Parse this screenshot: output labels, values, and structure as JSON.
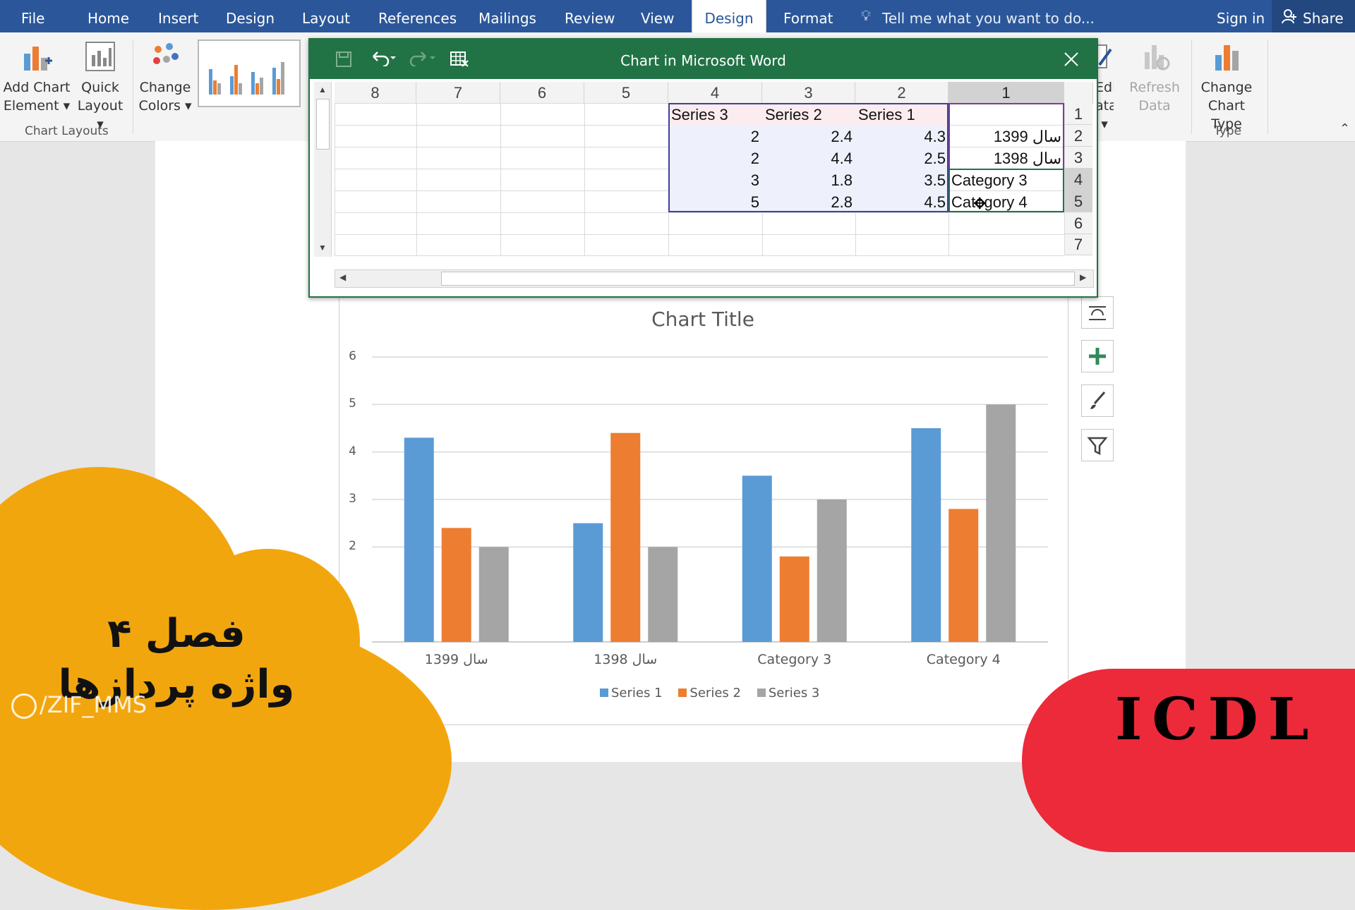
{
  "ribbon_tabs": {
    "file": "File",
    "home": "Home",
    "insert": "Insert",
    "design": "Design",
    "layout": "Layout",
    "references": "References",
    "mailings": "Mailings",
    "review": "Review",
    "view": "View",
    "chart_design": "Design",
    "format": "Format"
  },
  "tell_me": "Tell me what you want to do...",
  "sign_in": "Sign in",
  "share": "Share",
  "ribbon": {
    "add_chart_element": [
      "Add Chart",
      "Element ▾"
    ],
    "quick_layout": [
      "Quick",
      "Layout ▾"
    ],
    "change_colors": [
      "Change",
      "Colors ▾"
    ],
    "chart_layouts_group": "Chart Layouts",
    "edit_data": [
      "Edit",
      "ata ▾"
    ],
    "refresh_data": [
      "Refresh",
      "Data"
    ],
    "change_chart_type": [
      "Change",
      "Chart Type"
    ],
    "type_group": "Type"
  },
  "excel": {
    "title": "Chart in Microsoft Word",
    "columns": [
      "8",
      "7",
      "6",
      "5",
      "4",
      "3",
      "2",
      "1"
    ],
    "rows": [
      "1",
      "2",
      "3",
      "4",
      "5",
      "6",
      "7"
    ],
    "header": [
      "Series 3",
      "Series 2",
      "Series 1",
      ""
    ],
    "data": [
      [
        "2",
        "2.4",
        "4.3",
        "سال 1399"
      ],
      [
        "2",
        "4.4",
        "2.5",
        "سال 1398"
      ],
      [
        "3",
        "1.8",
        "3.5",
        "Category 3"
      ],
      [
        "5",
        "2.8",
        "4.5",
        "Category 4"
      ]
    ]
  },
  "chart_data": {
    "type": "bar",
    "title": "Chart Title",
    "categories": [
      "سال 1399",
      "سال 1398",
      "Category 3",
      "Category 4"
    ],
    "series": [
      {
        "name": "Series 1",
        "values": [
          4.3,
          2.5,
          3.5,
          4.5
        ],
        "color": "#5b9bd5"
      },
      {
        "name": "Series 2",
        "values": [
          2.4,
          4.4,
          1.8,
          2.8
        ],
        "color": "#ed7d31"
      },
      {
        "name": "Series 3",
        "values": [
          2,
          2,
          3,
          5
        ],
        "color": "#a5a5a5"
      }
    ],
    "ylim": [
      0,
      6
    ],
    "yticks": [
      "2",
      "3",
      "4",
      "5",
      "6"
    ],
    "grid": true,
    "legend": "bottom"
  },
  "overlay": {
    "chapter": "فصل ۴",
    "subject": "واژه پردازها",
    "watermark": "/ZIF_MMS",
    "brand": "ICDL"
  },
  "colors": {
    "word_blue": "#2b579a",
    "excel_green": "#217346",
    "overlay_orange": "#f2a60e",
    "brand_red": "#ed2a3a"
  }
}
